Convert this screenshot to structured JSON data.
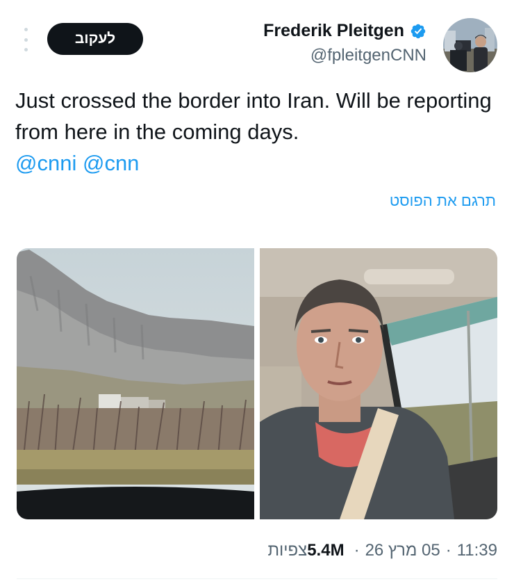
{
  "tweet": {
    "follow_label": "לעקוב",
    "author": {
      "display_name": "Frederik Pleitgen",
      "handle": "@fpleitgenCNN",
      "verified": true
    },
    "text": "Just crossed the border into Iran. Will be reporting from here in the coming days.",
    "mentions": [
      "@cnni",
      "@cnn"
    ],
    "translate_label": "תרגם את הפוסט",
    "meta": {
      "time": "11:39",
      "date": "05 מרץ 26",
      "views_count": "5.4M",
      "views_label": "צפיות"
    }
  },
  "icons": {
    "more": "vertical-dots-icon",
    "verified": "verified-badge-icon"
  },
  "colors": {
    "accent": "#1d9bf0",
    "text": "#0f1419",
    "secondary": "#536471",
    "follow_bg": "#0f1419"
  }
}
